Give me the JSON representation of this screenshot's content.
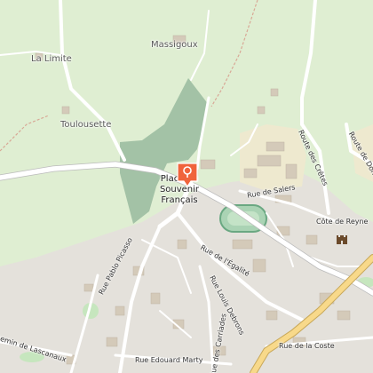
{
  "map": {
    "colors": {
      "land": "#dfeed2",
      "forest": "#8fb397",
      "urban": "#e4e1db",
      "road": "#ffffff",
      "main_road": "#f8d98a",
      "marker": "#f0643c"
    },
    "places": {
      "massigoux": "Massigoux",
      "la_limite": "La Limite",
      "toulousette": "Toulousette"
    },
    "poi": {
      "line1": "Place du",
      "line2": "Souvenir",
      "line3": "Français",
      "icon": "map-pin-icon"
    },
    "streets": {
      "rue_de_salers": "Rue de Salers",
      "route_des_cretes": "Route des Crêtes",
      "route_de_dom": "Route de Dom",
      "cote_de_reyne": "Côte de Reyne",
      "rue_de_legalite": "Rue de l'Égalité",
      "rue_louis_debrons": "Rue Louis Debrons",
      "rue_des_carriades": "Rue des Carriades",
      "rue_pablo_picasso": "Rue Pablo Picasso",
      "rue_edouard_marty": "Rue Edouard Marty",
      "rue_de_la_coste": "Rue de la Coste",
      "chemin_de_lascanaux": "Chemin de Lascanaux"
    },
    "icons": {
      "castle": "castle-icon"
    }
  }
}
